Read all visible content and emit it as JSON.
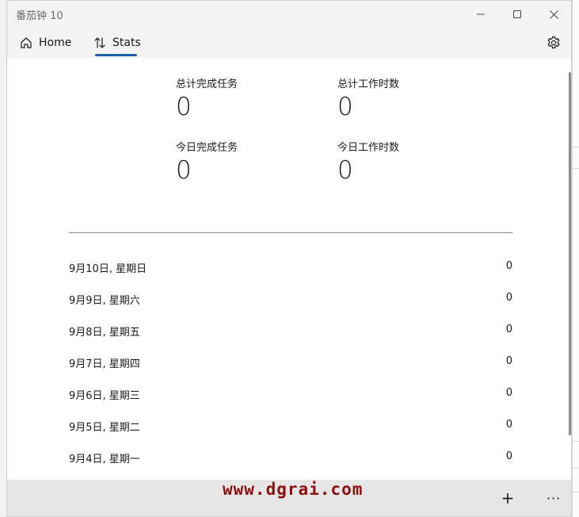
{
  "window": {
    "title": "番茄钟 10"
  },
  "nav": {
    "home_label": "Home",
    "stats_label": "Stats"
  },
  "stats": {
    "total_tasks_label": "总计完成任务",
    "total_tasks_value": "0",
    "total_hours_label": "总计工作时数",
    "total_hours_value": "0",
    "today_tasks_label": "今日完成任务",
    "today_tasks_value": "0",
    "today_hours_label": "今日工作时数",
    "today_hours_value": "0"
  },
  "days": [
    {
      "label": "9月10日, 星期日",
      "value": "0"
    },
    {
      "label": "9月9日, 星期六",
      "value": "0"
    },
    {
      "label": "9月8日, 星期五",
      "value": "0"
    },
    {
      "label": "9月7日, 星期四",
      "value": "0"
    },
    {
      "label": "9月6日, 星期三",
      "value": "0"
    },
    {
      "label": "9月5日, 星期二",
      "value": "0"
    },
    {
      "label": "9月4日, 星期一",
      "value": "0"
    }
  ],
  "bottom": {
    "add_glyph": "+",
    "more_glyph": "···"
  },
  "watermark": "www.dgrai.com",
  "icons": {
    "home": "home-icon",
    "stats": "sort-arrows-icon",
    "settings": "gear-icon",
    "minimize": "minimize-icon",
    "maximize": "maximize-icon",
    "close": "close-icon"
  },
  "colors": {
    "accent": "#1f5fa6",
    "watermark": "#8b0f0f"
  }
}
